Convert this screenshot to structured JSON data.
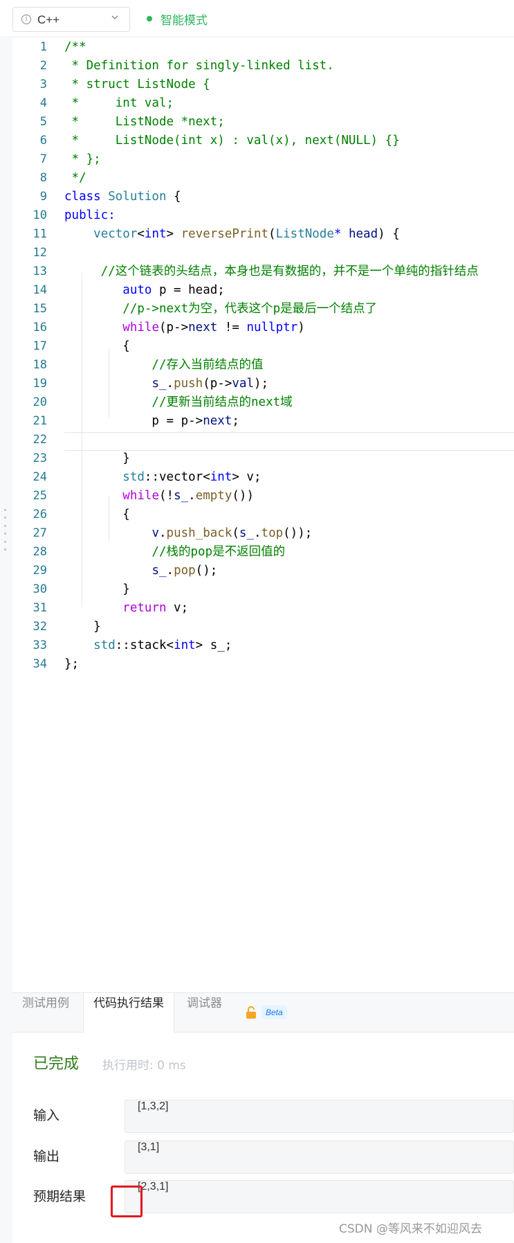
{
  "toolbar": {
    "language": "C++",
    "mode": "智能模式",
    "mode_color": "#2db55d"
  },
  "editor": {
    "lines": [
      {
        "n": "1",
        "tokens": [
          [
            "c",
            "/**"
          ]
        ]
      },
      {
        "n": "2",
        "tokens": [
          [
            "c",
            " * Definition for singly-linked list."
          ]
        ]
      },
      {
        "n": "3",
        "tokens": [
          [
            "c",
            " * struct ListNode {"
          ]
        ]
      },
      {
        "n": "4",
        "tokens": [
          [
            "c",
            " *     int val;"
          ]
        ]
      },
      {
        "n": "5",
        "tokens": [
          [
            "c",
            " *     ListNode *next;"
          ]
        ]
      },
      {
        "n": "6",
        "tokens": [
          [
            "c",
            " *     ListNode(int x) : val(x), next(NULL) {}"
          ]
        ]
      },
      {
        "n": "7",
        "tokens": [
          [
            "c",
            " * };"
          ]
        ]
      },
      {
        "n": "8",
        "tokens": [
          [
            "c",
            " */"
          ]
        ]
      },
      {
        "n": "9",
        "tokens": [
          [
            "k",
            "class "
          ],
          [
            "t",
            "Solution"
          ],
          [
            "p",
            " {"
          ]
        ]
      },
      {
        "n": "10",
        "tokens": [
          [
            "k",
            "public:"
          ]
        ]
      },
      {
        "n": "11",
        "tokens": [
          [
            "p",
            "    "
          ],
          [
            "t",
            "vector"
          ],
          [
            "p",
            "<"
          ],
          [
            "k",
            "int"
          ],
          [
            "p",
            "> "
          ],
          [
            "f",
            "reversePrint"
          ],
          [
            "p",
            "("
          ],
          [
            "t",
            "ListNode"
          ],
          [
            "k",
            "*"
          ],
          [
            "p",
            " "
          ],
          [
            "v",
            "head"
          ],
          [
            "p",
            ") {"
          ]
        ]
      },
      {
        "n": "12",
        "tokens": [
          [
            "p",
            ""
          ]
        ]
      },
      {
        "n": "13",
        "tokens": [
          [
            "c",
            "     //这个链表的头结点，本身也是有数据的，并不是一个单纯的指针结点"
          ]
        ]
      },
      {
        "n": "14",
        "tokens": [
          [
            "p",
            "        "
          ],
          [
            "k",
            "auto"
          ],
          [
            "p",
            " p = head;"
          ]
        ]
      },
      {
        "n": "15",
        "tokens": [
          [
            "c",
            "        //p->next为空，代表这个p是最后一个结点了"
          ]
        ]
      },
      {
        "n": "16",
        "tokens": [
          [
            "p",
            "        "
          ],
          [
            "ctl",
            "while"
          ],
          [
            "p",
            "(p->"
          ],
          [
            "v",
            "next"
          ],
          [
            "p",
            " != "
          ],
          [
            "k",
            "nullptr"
          ],
          [
            "p",
            ")"
          ]
        ]
      },
      {
        "n": "17",
        "tokens": [
          [
            "p",
            "        {"
          ]
        ]
      },
      {
        "n": "18",
        "tokens": [
          [
            "c",
            "            //存入当前结点的值"
          ]
        ]
      },
      {
        "n": "19",
        "tokens": [
          [
            "p",
            "            "
          ],
          [
            "v",
            "s_"
          ],
          [
            "p",
            "."
          ],
          [
            "f",
            "push"
          ],
          [
            "p",
            "(p->"
          ],
          [
            "v",
            "val"
          ],
          [
            "p",
            ");"
          ]
        ]
      },
      {
        "n": "20",
        "tokens": [
          [
            "c",
            "            //更新当前结点的next域"
          ]
        ]
      },
      {
        "n": "21",
        "tokens": [
          [
            "p",
            "            p = p->"
          ],
          [
            "v",
            "next"
          ],
          [
            "p",
            ";"
          ]
        ]
      },
      {
        "n": "22",
        "tokens": [
          [
            "p",
            ""
          ]
        ]
      },
      {
        "n": "23",
        "tokens": [
          [
            "p",
            "        }"
          ]
        ]
      },
      {
        "n": "24",
        "tokens": [
          [
            "p",
            "        "
          ],
          [
            "t",
            "std"
          ],
          [
            "p",
            "::vector<"
          ],
          [
            "k",
            "int"
          ],
          [
            "p",
            "> v;"
          ]
        ]
      },
      {
        "n": "25",
        "tokens": [
          [
            "p",
            "        "
          ],
          [
            "ctl",
            "while"
          ],
          [
            "p",
            "(!"
          ],
          [
            "v",
            "s_"
          ],
          [
            "p",
            "."
          ],
          [
            "f",
            "empty"
          ],
          [
            "p",
            "())"
          ]
        ]
      },
      {
        "n": "26",
        "tokens": [
          [
            "p",
            "        {"
          ]
        ]
      },
      {
        "n": "27",
        "tokens": [
          [
            "p",
            "            "
          ],
          [
            "v",
            "v"
          ],
          [
            "p",
            "."
          ],
          [
            "f",
            "push_back"
          ],
          [
            "p",
            "("
          ],
          [
            "v",
            "s_"
          ],
          [
            "p",
            "."
          ],
          [
            "f",
            "top"
          ],
          [
            "p",
            "());"
          ]
        ]
      },
      {
        "n": "28",
        "tokens": [
          [
            "c",
            "            //栈的pop是不返回值的"
          ]
        ]
      },
      {
        "n": "29",
        "tokens": [
          [
            "p",
            "            "
          ],
          [
            "v",
            "s_"
          ],
          [
            "p",
            "."
          ],
          [
            "f",
            "pop"
          ],
          [
            "p",
            "();"
          ]
        ]
      },
      {
        "n": "30",
        "tokens": [
          [
            "p",
            "        }"
          ]
        ]
      },
      {
        "n": "31",
        "tokens": [
          [
            "p",
            "        "
          ],
          [
            "ctl",
            "return"
          ],
          [
            "p",
            " v;"
          ]
        ]
      },
      {
        "n": "32",
        "tokens": [
          [
            "p",
            "    }"
          ]
        ]
      },
      {
        "n": "33",
        "tokens": [
          [
            "p",
            "    "
          ],
          [
            "t",
            "std"
          ],
          [
            "p",
            "::stack<"
          ],
          [
            "k",
            "int"
          ],
          [
            "p",
            "> s_;"
          ]
        ]
      },
      {
        "n": "34",
        "tokens": [
          [
            "p",
            "};"
          ]
        ]
      }
    ]
  },
  "panel": {
    "tabs": [
      "测试用例",
      "代码执行结果",
      "调试器"
    ],
    "beta": "Beta",
    "status": "已完成",
    "exec_time": "执行用时: 0 ms",
    "rows": [
      {
        "label": "输入",
        "value": "[1,3,2]"
      },
      {
        "label": "输出",
        "value": "[3,1]"
      },
      {
        "label": "预期结果",
        "value": "[2,3,1]"
      }
    ]
  },
  "watermark": "CSDN @等风来不如迎风去"
}
